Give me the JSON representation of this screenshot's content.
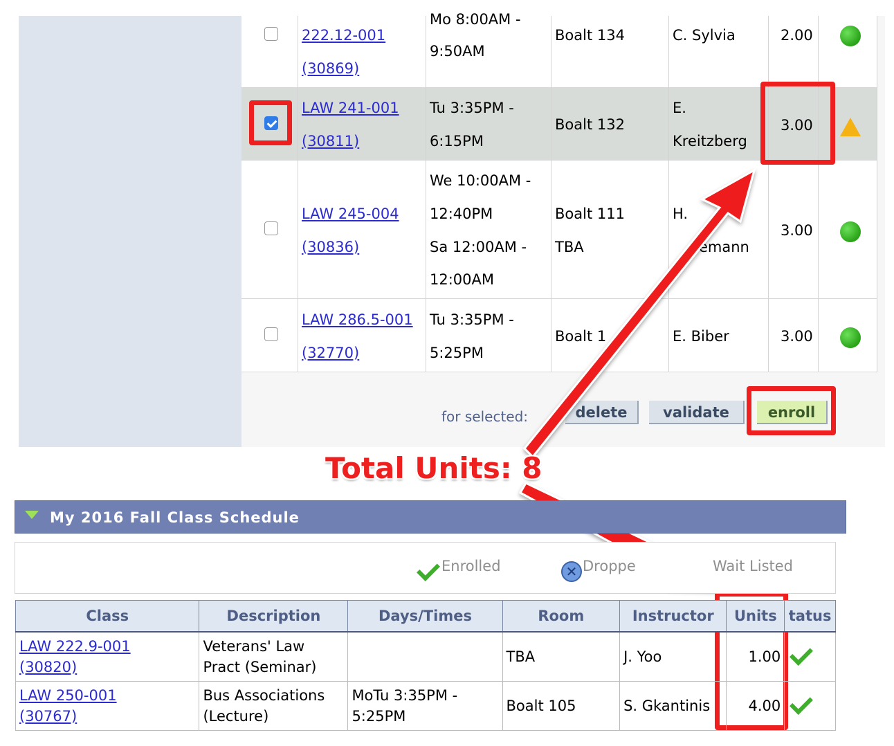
{
  "cart": {
    "rows": [
      {
        "class_code": "222.12-001",
        "class_num": "(30869)",
        "time1": "Mo 8:00AM -",
        "time2": "9:50AM",
        "room": "Boalt 134",
        "instr1": "C. Sylvia",
        "instr2": "",
        "units": "2.00",
        "status": "green-dot",
        "checked": false
      },
      {
        "class_code": "LAW 241-001",
        "class_num": "(30811)",
        "time1": "Tu 3:35PM -",
        "time2": "6:15PM",
        "room": "Boalt 132",
        "instr1": "E.",
        "instr2": "Kreitzberg",
        "units": "3.00",
        "status": "warning-triangle",
        "checked": true
      },
      {
        "class_code": "LAW 245-004",
        "class_num": "(30836)",
        "time1": "We 10:00AM -",
        "time2": "12:40PM",
        "time3": "Sa 12:00AM -",
        "time4": "12:00AM",
        "room": "Boalt 111",
        "room2": "TBA",
        "instr1": "H.",
        "instr2": "emann",
        "units": "3.00",
        "status": "green-dot",
        "checked": false
      },
      {
        "class_code": "LAW 286.5-001",
        "class_num": "(32770)",
        "time1": "Tu 3:35PM -",
        "time2": "5:25PM",
        "room": "Boalt 1",
        "room_tail": "1",
        "instr1": "E. Biber",
        "units": "3.00",
        "status": "green-dot",
        "checked": false
      }
    ],
    "for_selected_label": "for selected:",
    "buttons": {
      "delete": "delete",
      "validate": "validate",
      "enroll": "enroll"
    }
  },
  "annotation": "Total Units: 8",
  "schedule": {
    "title": "My 2016 Fall Class Schedule",
    "legend": {
      "enrolled": "Enrolled",
      "dropped": "Droppe",
      "wait_listed": "Wait Listed"
    },
    "headers": [
      "Class",
      "Description",
      "Days/Times",
      "Room",
      "Instructor",
      "Units",
      "tatus"
    ],
    "rows": [
      {
        "class1": "LAW 222.9-001",
        "class2": "(30820)",
        "desc1": "Veterans' Law",
        "desc2": "Pract (Seminar)",
        "time1": "",
        "time2": "",
        "room": "TBA",
        "instructor": "J. Yoo",
        "units": "1.00"
      },
      {
        "class1": "LAW 250-001",
        "class2": "(30767)",
        "desc1": "Bus Associations",
        "desc2": "(Lecture)",
        "time1": "MoTu 3:35PM -",
        "time2": "5:25PM",
        "room": "Boalt 105",
        "instructor": "S. Gkantinis",
        "units": "4.00"
      }
    ]
  },
  "colors": {
    "annotation_red": "#ee1f1f",
    "header_blue": "#7080b2",
    "link": "#2b2bd1"
  }
}
